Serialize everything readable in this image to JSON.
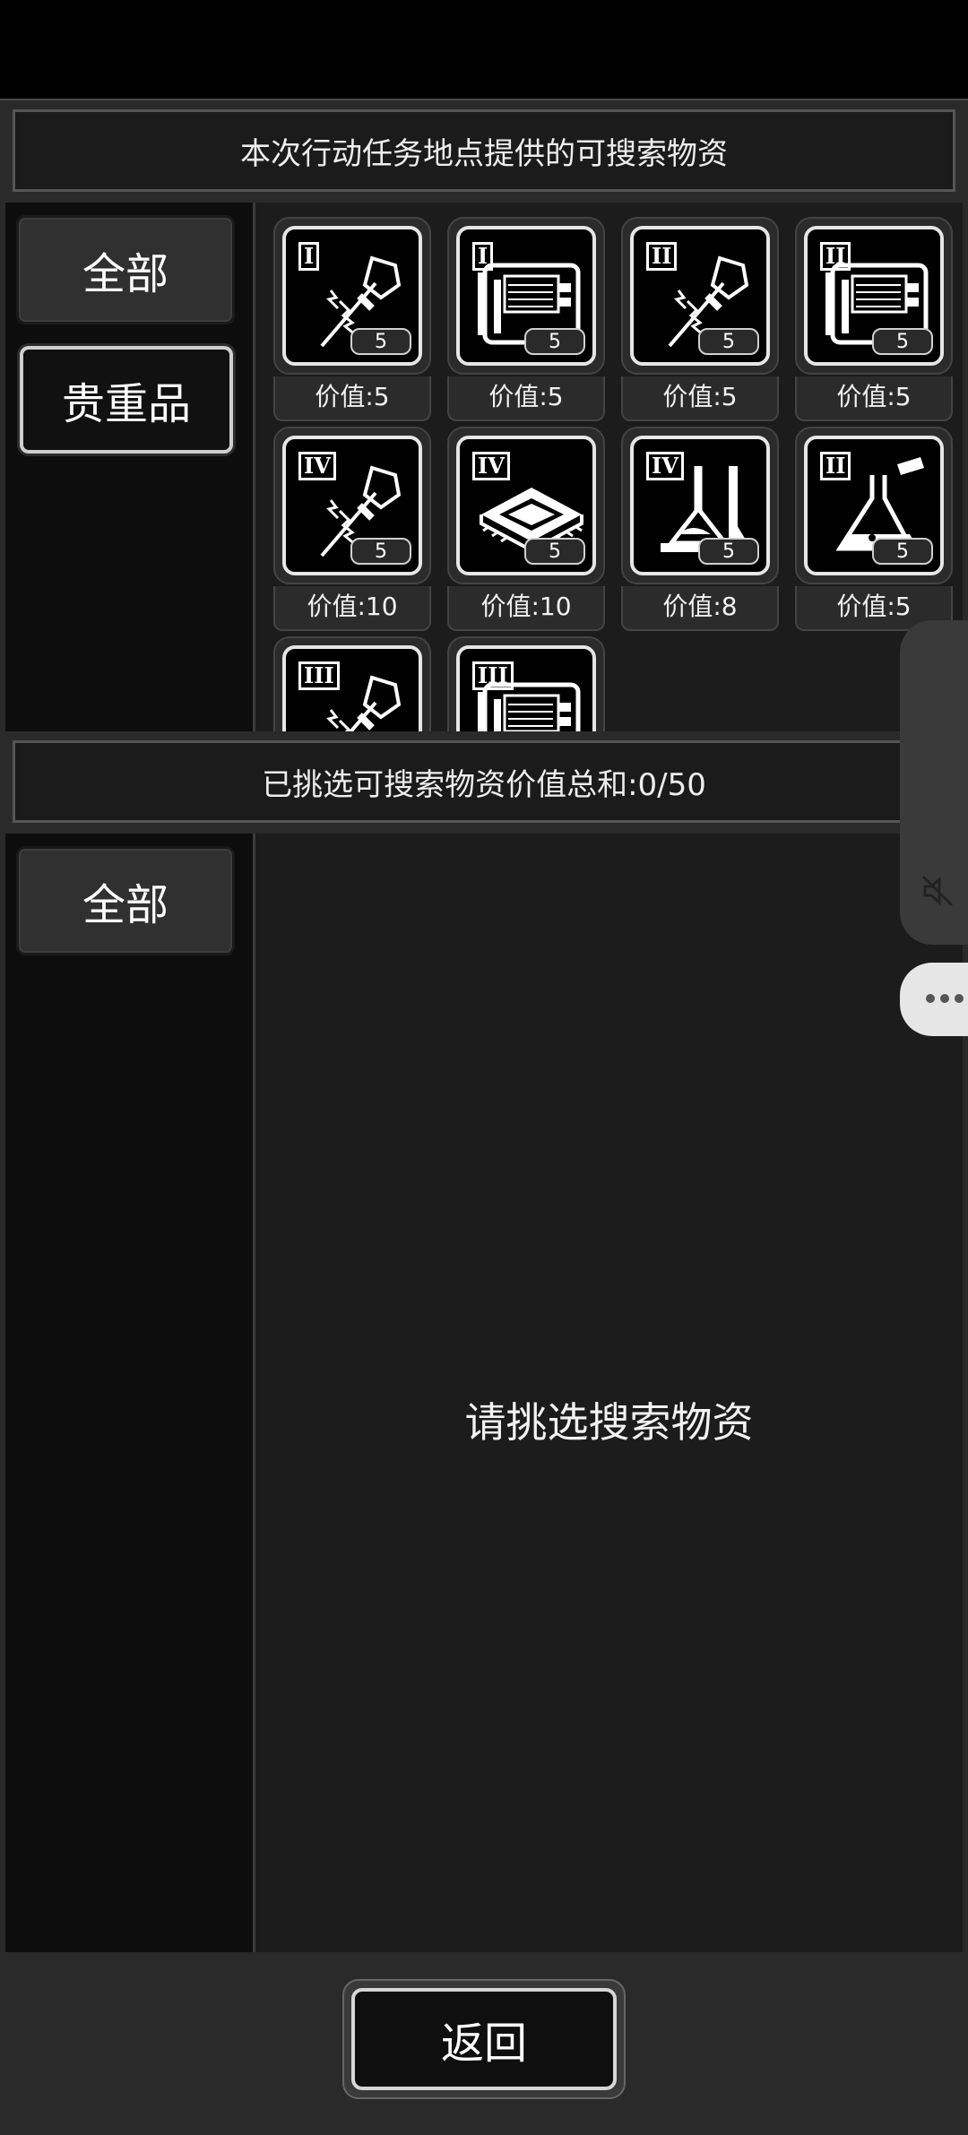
{
  "top_banner": {
    "title": "本次行动任务地点提供的可搜索物资"
  },
  "top_categories": [
    {
      "label": "全部"
    },
    {
      "label": "贵重品"
    }
  ],
  "items": [
    {
      "tier": "I",
      "kind": "tool",
      "count": "5",
      "price": "价值:5"
    },
    {
      "tier": "I",
      "kind": "device",
      "count": "5",
      "price": "价值:5"
    },
    {
      "tier": "II",
      "kind": "tool",
      "count": "5",
      "price": "价值:5"
    },
    {
      "tier": "II",
      "kind": "device",
      "count": "5",
      "price": "价值:5"
    },
    {
      "tier": "IV",
      "kind": "tool",
      "count": "5",
      "price": "价值:10"
    },
    {
      "tier": "IV",
      "kind": "chip",
      "count": "5",
      "price": "价值:10"
    },
    {
      "tier": "IV",
      "kind": "lab",
      "count": "5",
      "price": "价值:8"
    },
    {
      "tier": "II",
      "kind": "flask",
      "count": "5",
      "price": "价值:5"
    },
    {
      "tier": "III",
      "kind": "tool",
      "count": "",
      "price": ""
    },
    {
      "tier": "III",
      "kind": "device",
      "count": "",
      "price": ""
    }
  ],
  "selected_banner": {
    "title": "已挑选可搜索物资价值总和:0/50"
  },
  "bottom_categories": [
    {
      "label": "全部"
    }
  ],
  "empty_hint": "请挑选搜索物资",
  "return_button": {
    "label": "返回"
  }
}
